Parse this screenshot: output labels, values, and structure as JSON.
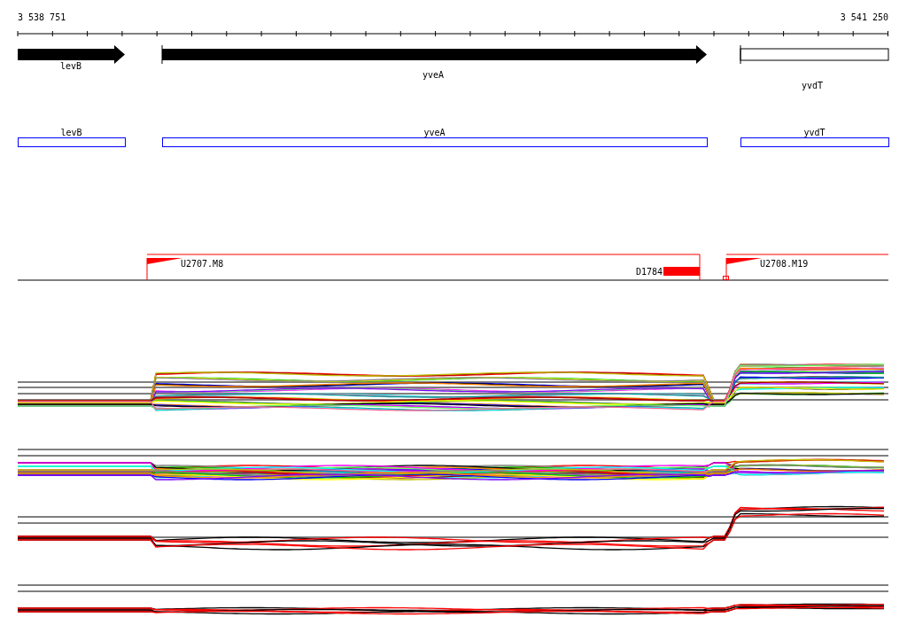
{
  "ruler": {
    "start": "3 538 751",
    "end": "3 541 250"
  },
  "genes": [
    {
      "name": "levB",
      "kind": "arrow"
    },
    {
      "name": "yveA",
      "kind": "arrow"
    },
    {
      "name": "yvdT",
      "kind": "outline"
    }
  ],
  "annotations": [
    {
      "name": "levB"
    },
    {
      "name": "yveA"
    },
    {
      "name": "yvdT"
    }
  ],
  "features": [
    {
      "label": "U2707.M8",
      "kind": "promoter"
    },
    {
      "label": "D1784",
      "kind": "terminator"
    },
    {
      "label": "U2708.M19",
      "kind": "promoter"
    }
  ]
}
